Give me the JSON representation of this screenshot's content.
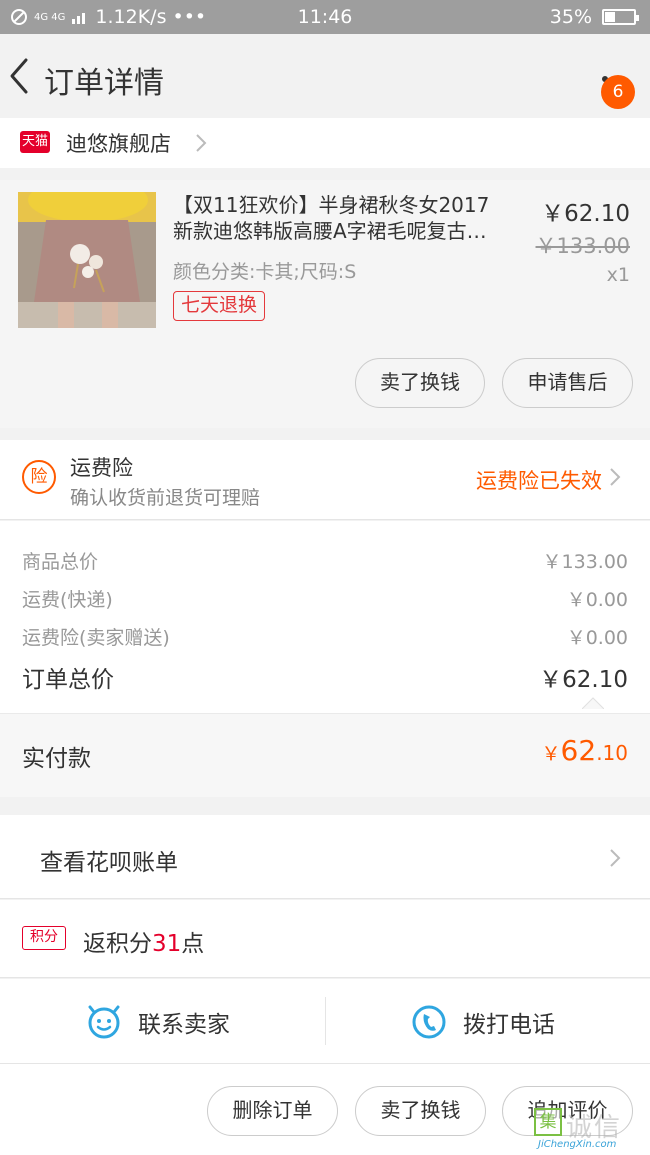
{
  "status_bar": {
    "network": "4G 4G",
    "speed": "1.12K/s",
    "dots": "•••",
    "time": "11:46",
    "battery": "35%",
    "battery_level": 0.35
  },
  "nav": {
    "title": "订单详情",
    "badge": "6"
  },
  "shop": {
    "badge": "天猫",
    "name": "迪悠旗舰店"
  },
  "product": {
    "title_line1": "【双11狂欢价】半身裙秋冬女2017",
    "title_line2": "新款迪悠韩版高腰A字裙毛呢复古…",
    "sku": "颜色分类:卡其;尺码:S",
    "tag": "七天退换",
    "price": "￥62.10",
    "original_price": "￥133.00",
    "quantity": "x1",
    "btn_exchange": "卖了换钱",
    "btn_after_sale": "申请售后"
  },
  "insurance": {
    "icon": "险",
    "title": "运费险",
    "subtitle": "确认收货前退货可理赔",
    "status": "运费险已失效"
  },
  "prices": {
    "rows": [
      {
        "label": "商品总价",
        "value": "￥133.00"
      },
      {
        "label": "运费(快递)",
        "value": "￥0.00"
      },
      {
        "label": "运费险(卖家赠送)",
        "value": "￥0.00"
      }
    ],
    "total_label": "订单总价",
    "total_value": "￥62.10"
  },
  "paid": {
    "label": "实付款",
    "yen": "￥",
    "int": "62",
    "dec": ".10"
  },
  "huabei": {
    "label": "查看花呗账单"
  },
  "points": {
    "tag": "积分",
    "prefix": "返积分",
    "number": "31",
    "suffix": "点"
  },
  "contact": {
    "seller": "联系卖家",
    "phone": "拨打电话"
  },
  "actions": {
    "delete": "删除订单",
    "exchange": "卖了换钱",
    "review": "追加评价"
  },
  "watermark": {
    "mark": "集",
    "cn": "诚信",
    "url": "JiChengXin.com"
  },
  "colors": {
    "accent_orange": "#ff5a00",
    "tmall_red": "#e4002b",
    "status_bar": "#9e9e9e",
    "link_blue": "#3aa3d8"
  }
}
